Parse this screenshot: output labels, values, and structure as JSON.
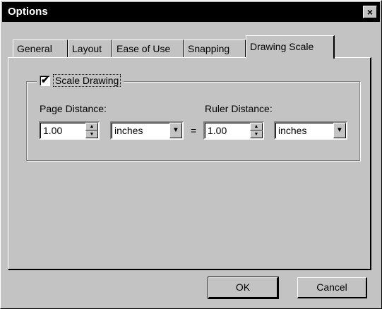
{
  "window": {
    "title": "Options",
    "close_glyph": "×"
  },
  "tabs": [
    {
      "label": "General",
      "active": false
    },
    {
      "label": "Layout",
      "active": false
    },
    {
      "label": "Ease of Use",
      "active": false
    },
    {
      "label": "Snapping",
      "active": false
    },
    {
      "label": "Drawing Scale",
      "active": true
    }
  ],
  "scale_group": {
    "checkbox_label": "Scale Drawing",
    "checked": true,
    "check_glyph": "✔"
  },
  "page_distance": {
    "label": "Page Distance:",
    "value": "1.00",
    "unit": "inches"
  },
  "ruler_distance": {
    "label": "Ruler Distance:",
    "value": "1.00",
    "unit": "inches"
  },
  "equals": "=",
  "spinner_glyphs": {
    "up": "▲",
    "down": "▼"
  },
  "dropdown_glyph": "▼",
  "buttons": {
    "ok": "OK",
    "cancel": "Cancel"
  }
}
